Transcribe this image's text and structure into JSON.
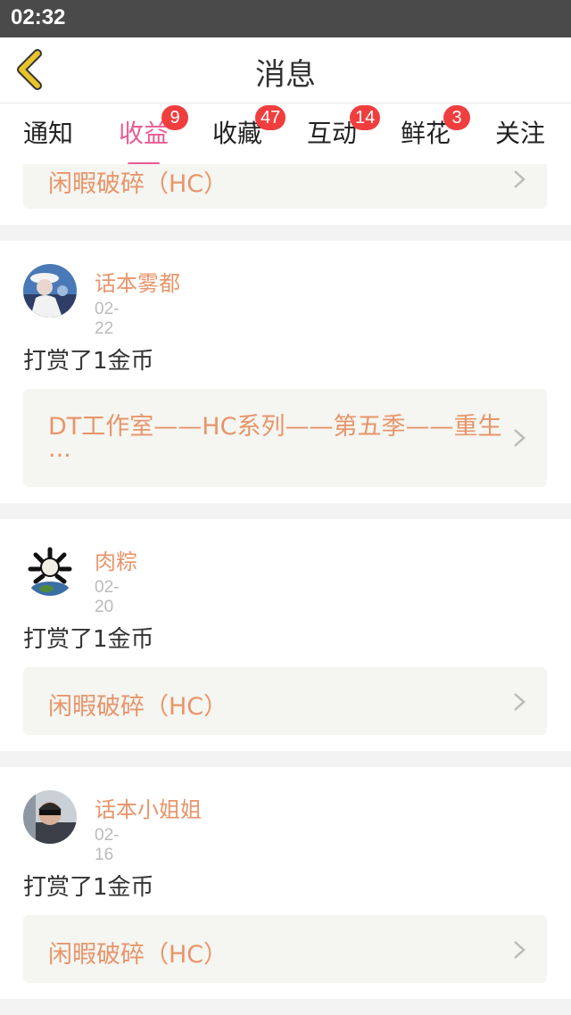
{
  "status": {
    "time": "02:32"
  },
  "header": {
    "title": "消息"
  },
  "tabs": [
    {
      "label": "通知",
      "badge": ""
    },
    {
      "label": "收益",
      "badge": "9"
    },
    {
      "label": "收藏",
      "badge": "47"
    },
    {
      "label": "互动",
      "badge": "14"
    },
    {
      "label": "鲜花",
      "badge": "3"
    },
    {
      "label": "关注",
      "badge": ""
    }
  ],
  "active_tab": "收益",
  "items": [
    {
      "work": "闲暇破碎（HC）"
    },
    {
      "user": "话本雾都",
      "date": "02-22",
      "message": "打赏了1金币",
      "work_line1": "DT工作室——HC系列——第五季——重生",
      "work_line2": "..."
    },
    {
      "user": "肉粽",
      "date": "02-20",
      "message": "打赏了1金币",
      "work": "闲暇破碎（HC）"
    },
    {
      "user": "话本小姐姐",
      "date": "02-16",
      "message": "打赏了1金币",
      "work": "闲暇破碎（HC）"
    }
  ],
  "colors": {
    "accent": "#e85c94",
    "link_text": "#e7956a",
    "badge": "#f03e3e",
    "back_arrow": "#e8c32a"
  }
}
